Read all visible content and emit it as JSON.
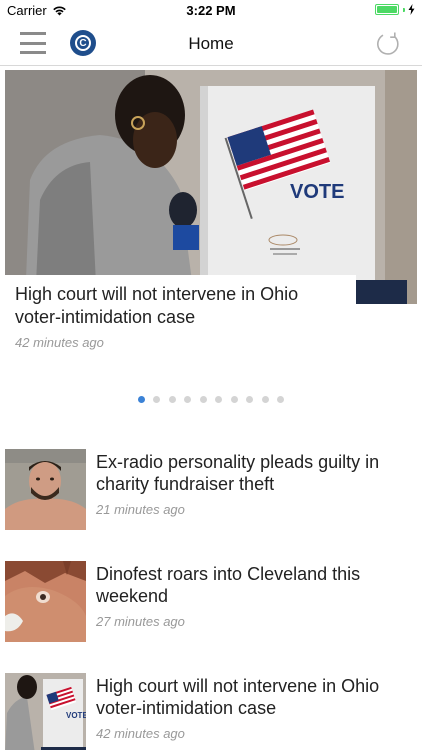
{
  "status_bar": {
    "carrier": "Carrier",
    "time": "3:22 PM",
    "battery_level": 1.0,
    "battery_color": "#4cd964"
  },
  "nav": {
    "title": "Home",
    "menu_icon": "hamburger-icon",
    "logo_letter": "C",
    "refresh_icon": "refresh-icon"
  },
  "hero": {
    "title": "High court will not intervene in Ohio voter-intimidation case",
    "time": "42 minutes ago",
    "booth_text": "VOTE"
  },
  "pager": {
    "count": 10,
    "active_index": 0,
    "active_color": "#3b82d6"
  },
  "stories": [
    {
      "title": "Ex-radio personality pleads guilty in charity fundraiser theft",
      "time": "21 minutes ago",
      "thumb": "mugshot-photo"
    },
    {
      "title": "Dinofest roars into Cleveland this weekend",
      "time": "27 minutes ago",
      "thumb": "dinosaur-photo"
    },
    {
      "title": "High court will not intervene in Ohio voter-intimidation case",
      "time": "42 minutes ago",
      "thumb": "voting-booth-photo",
      "booth_text": "VOTE"
    }
  ]
}
